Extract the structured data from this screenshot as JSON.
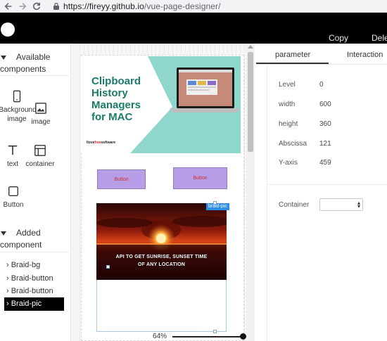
{
  "browser": {
    "url_host": "https://fireyy.github.io",
    "url_path": "/vue-page-designer/"
  },
  "header": {
    "copy_label": "Copy",
    "delete_label": "Dele"
  },
  "left_panel": {
    "available_title": "Available components",
    "components": [
      {
        "label": "Background image",
        "icon": "phone-icon"
      },
      {
        "label": "image",
        "icon": "image-icon"
      },
      {
        "label": "text",
        "icon": "text-icon"
      },
      {
        "label": "container",
        "icon": "container-icon"
      },
      {
        "label": "Button",
        "icon": "square-icon"
      }
    ],
    "added_title": "Added component",
    "added": [
      "› Braid-bg",
      "› Braid-button",
      "› Braid-button",
      "› Braid-pic"
    ]
  },
  "canvas": {
    "banner": {
      "title_lines": [
        "Clipboard",
        "History",
        "Managers",
        "for MAC"
      ],
      "brand_a": "Ilove",
      "brand_b": "free",
      "brand_c": "software"
    },
    "buttons": [
      "Button",
      "Button"
    ],
    "pic": {
      "label": "braid-pic",
      "caption_1": "API TO GET SUNRISE, SUNSET TIME",
      "caption_2": "OF ANY LOCATION"
    },
    "zoom": "64%"
  },
  "right_panel": {
    "tabs": [
      "parameter",
      "Interaction"
    ],
    "active_tab": "parameter",
    "props": [
      {
        "key": "Level",
        "value": "0"
      },
      {
        "key": "width",
        "value": "600"
      },
      {
        "key": "height",
        "value": "360"
      },
      {
        "key": "Abscissa",
        "value": "121"
      },
      {
        "key": "Y-axis",
        "value": "459"
      }
    ],
    "container_label": "Container",
    "container_value": ""
  },
  "colors": {
    "banner_text": "#1b7a69",
    "banner_teal": "#8fd6cc",
    "button_fill": "#b79ee6",
    "button_text": "#d0302b",
    "selection": "#2e8fe5"
  }
}
